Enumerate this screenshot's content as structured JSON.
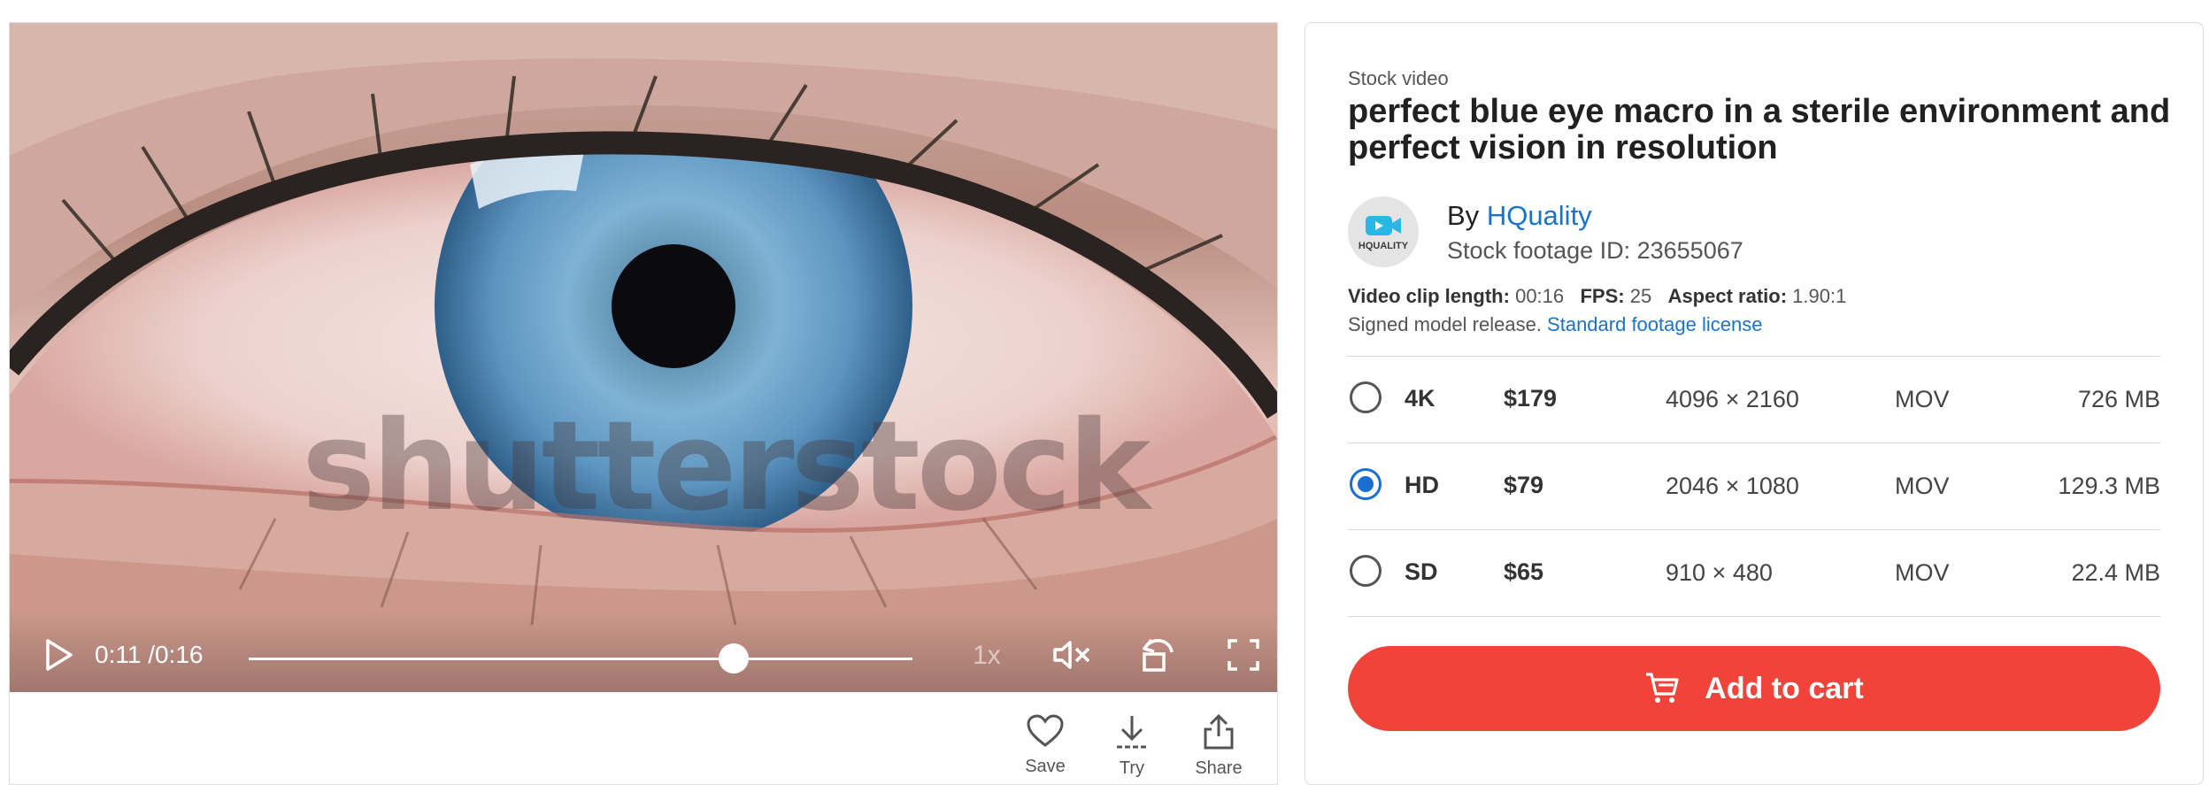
{
  "player": {
    "watermark": "shutterstock",
    "time_current": "0:11",
    "time_total": "0:16",
    "progress": 0.73,
    "speed": "1x",
    "icons": [
      "play-icon",
      "mute-icon",
      "loop-icon",
      "fullscreen-icon"
    ]
  },
  "actions": [
    {
      "icon": "heart-icon",
      "label": "Save"
    },
    {
      "icon": "download-icon",
      "label": "Try"
    },
    {
      "icon": "share-icon",
      "label": "Share"
    }
  ],
  "product": {
    "eyebrow": "Stock video",
    "title": "perfect blue eye macro in a sterile environment and perfect vision in resolution",
    "by_prefix": "By",
    "author": "HQuality",
    "avatar_text": "HQUALITY",
    "footage_id": "Stock footage ID: 23655067",
    "clip_length_label": "Video clip length:",
    "clip_length": "00:16",
    "fps_label": "FPS:",
    "fps": "25",
    "aspect_label": "Aspect ratio:",
    "aspect": "1.90:1",
    "release_text": "Signed model release.",
    "license_link": "Standard footage license"
  },
  "options": [
    {
      "quality": "4K",
      "price": "$179",
      "resolution": "4096 × 2160",
      "format": "MOV",
      "size": "726 MB",
      "selected": false
    },
    {
      "quality": "HD",
      "price": "$79",
      "resolution": "2046 × 1080",
      "format": "MOV",
      "size": "129.3 MB",
      "selected": true
    },
    {
      "quality": "SD",
      "price": "$65",
      "resolution": "910 × 480",
      "format": "MOV",
      "size": "22.4 MB",
      "selected": false
    }
  ],
  "cart": {
    "label": "Add to cart"
  },
  "colors": {
    "accent_red": "#f0443a",
    "link_blue": "#1a73c9",
    "radio_blue": "#1a6fd1"
  }
}
